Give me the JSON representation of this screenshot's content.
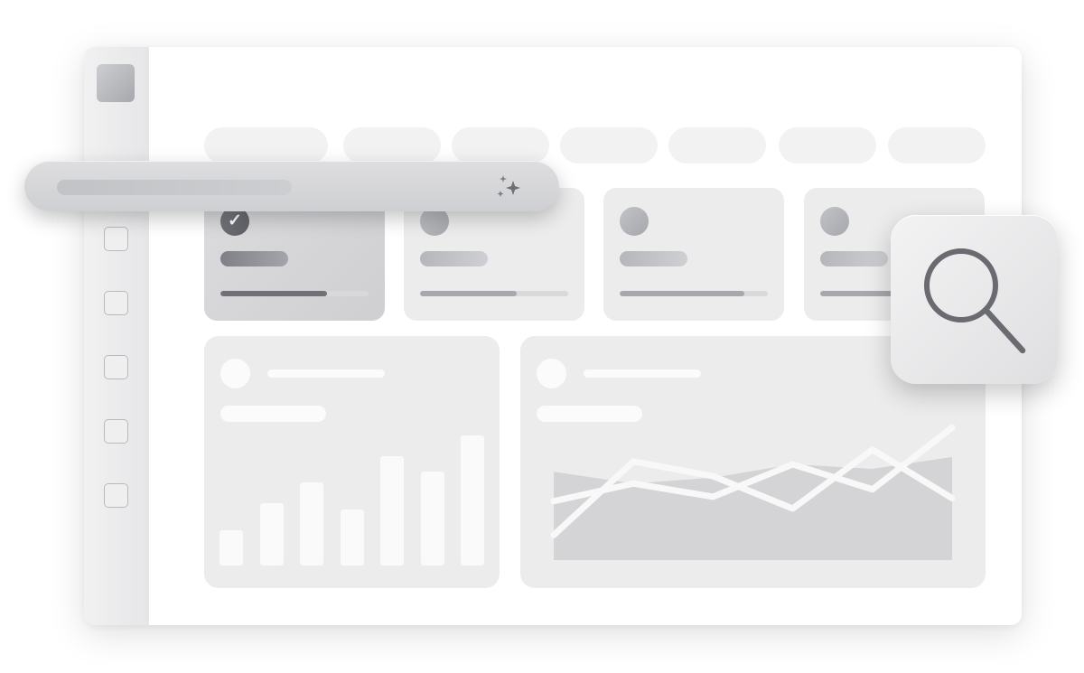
{
  "colors": {
    "background": "#ffffff",
    "sidebar": "#e9e9eb",
    "card": "#ececed",
    "accent": "#6e6f75",
    "placeholder": "#fbfbfb"
  },
  "icons": {
    "logo": "app-logo-square",
    "check": "✓",
    "sparkle": "sparkle-icon",
    "search": "magnifier-icon"
  },
  "sidebar": {
    "checkbox_count": 5
  },
  "filter_pill_count": 7,
  "stat_cards": [
    {
      "active": true,
      "progress": 0.72
    },
    {
      "active": false,
      "progress": 0.65
    },
    {
      "active": false,
      "progress": 0.84
    },
    {
      "active": false,
      "progress": 0.58
    }
  ],
  "chart_data": [
    {
      "type": "bar",
      "categories": [
        "",
        "",
        "",
        "",
        "",
        "",
        ""
      ],
      "values": [
        27,
        48,
        64,
        43,
        84,
        72,
        100
      ],
      "ylim": [
        0,
        100
      ],
      "grid": false,
      "legend": "none"
    },
    {
      "type": "line",
      "x": [
        0,
        1,
        2,
        3,
        4,
        5
      ],
      "series": [
        {
          "values": [
            17,
            67,
            57,
            35,
            75,
            42
          ]
        },
        {
          "values": [
            40,
            52,
            43,
            65,
            48,
            90
          ]
        }
      ],
      "area": [
        60,
        52,
        56,
        65,
        62,
        70
      ],
      "ylim": [
        0,
        100
      ],
      "grid": false,
      "legend": "none"
    }
  ]
}
